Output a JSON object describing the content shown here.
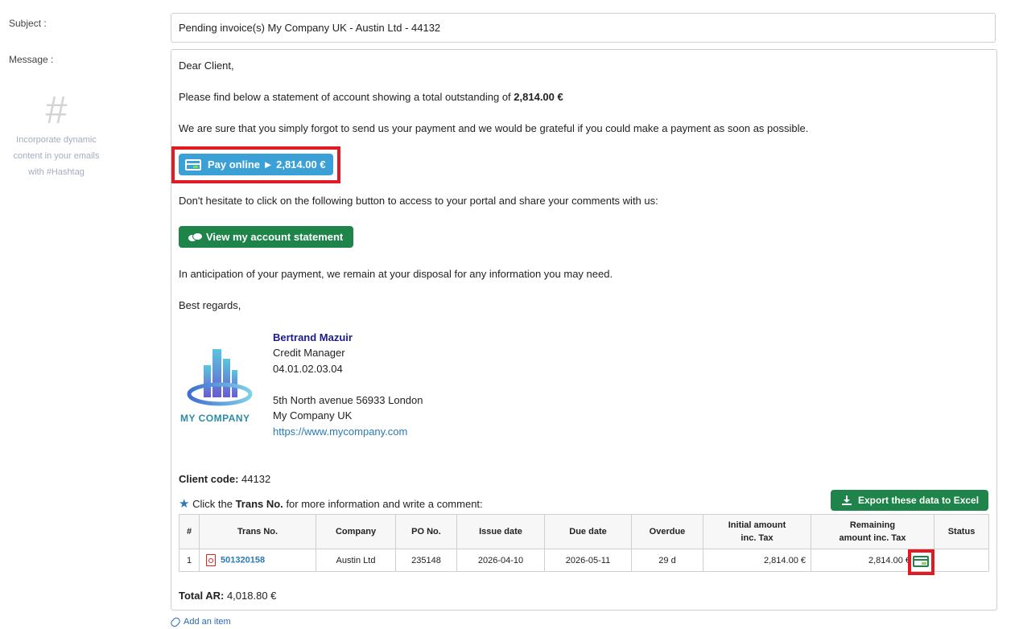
{
  "form": {
    "subject_label": "Subject :",
    "message_label": "Message :",
    "subject_value": "Pending invoice(s) My Company UK - Austin Ltd - 44132"
  },
  "hashtag": {
    "symbol": "#",
    "line1": "Incorporate dynamic",
    "line2": "content in your emails",
    "line3": "with #Hashtag"
  },
  "message": {
    "greeting": "Dear Client,",
    "statement_text": "Please find below a statement of account showing a total outstanding of",
    "total_outstanding": "2,814.00 €",
    "forgot_text": "We are sure that you simply forgot to send us your payment and we would be grateful if you could make a payment as soon as possible.",
    "pay_button_label": "Pay online ► 2,814.00 €",
    "portal_text": "Don't hesitate to click on the following button to access to your portal and share your comments with us:",
    "view_button_label": "View my account statement",
    "anticipation_text": "In anticipation of your payment, we remain at your disposal for any information you may need.",
    "regards": "Best regards,"
  },
  "signature": {
    "name": "Bertrand Mazuir",
    "role": "Credit Manager",
    "phone": "04.01.02.03.04",
    "address": "5th North avenue 56933 London",
    "company": "My Company UK",
    "website": "https://www.mycompany.com",
    "logo_text": "MY COMPANY"
  },
  "account": {
    "client_code_label": "Client code:",
    "client_code": "44132",
    "instruction_prefix": "Click the",
    "instruction_bold": "Trans No.",
    "instruction_suffix": "for more information and write a comment:",
    "export_button_label": "Export these data to Excel",
    "total_ar_label": "Total AR:",
    "total_ar_value": "4,018.80 €"
  },
  "table": {
    "headers": {
      "num": "#",
      "trans_no": "Trans No.",
      "company": "Company",
      "po_no": "PO No.",
      "issue_date": "Issue date",
      "due_date": "Due date",
      "overdue": "Overdue",
      "initial_amount_1": "Initial amount",
      "initial_amount_2": "inc. Tax",
      "remaining_amount_1": "Remaining",
      "remaining_amount_2": "amount inc. Tax",
      "status": "Status"
    },
    "rows": [
      {
        "num": "1",
        "trans_no": "501320158",
        "company": "Austin Ltd",
        "po_no": "235148",
        "issue_date": "2026-04-10",
        "due_date": "2026-05-11",
        "overdue": "29 d",
        "initial_amount": "2,814.00 €",
        "remaining_amount": "2,814.00 €",
        "status": ""
      }
    ]
  },
  "footer": {
    "add_item": "Add an item"
  },
  "colors": {
    "pay_button": "#3aa0d6",
    "green_button": "#1e8449",
    "highlight_red": "#e01b24",
    "link_blue": "#2a7ab5",
    "signature_name": "#1b1b8c"
  }
}
